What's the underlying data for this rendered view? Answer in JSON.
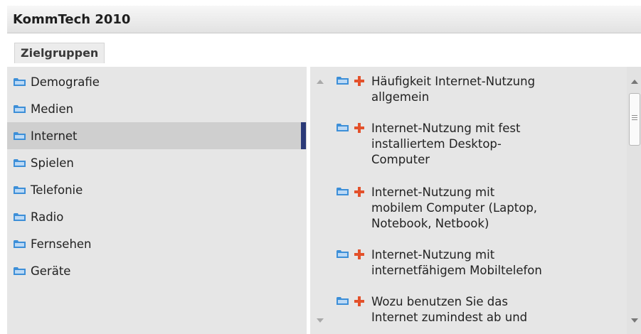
{
  "app": {
    "title": "KommTech 2010"
  },
  "tabs": [
    {
      "label": "Zielgruppen"
    }
  ],
  "categories": [
    {
      "label": "Demografie"
    },
    {
      "label": "Medien"
    },
    {
      "label": "Internet",
      "selected": true
    },
    {
      "label": "Spielen"
    },
    {
      "label": "Telefonie"
    },
    {
      "label": "Radio"
    },
    {
      "label": "Fernsehen"
    },
    {
      "label": "Geräte"
    }
  ],
  "items": [
    {
      "lines": [
        "Häufigkeit Internet-Nutzung",
        "allgemein"
      ]
    },
    {
      "lines": [
        "Internet-Nutzung mit fest",
        "installiertem Desktop-",
        "Computer"
      ]
    },
    {
      "lines": [
        "Internet-Nutzung mit",
        "mobilem Computer (Laptop,",
        "Notebook, Netbook)"
      ]
    },
    {
      "lines": [
        "Internet-Nutzung mit",
        "internetfähigem Mobiltelefon"
      ]
    },
    {
      "lines": [
        "Wozu benutzen Sie das",
        "Internet zumindest ab und"
      ]
    }
  ],
  "icons": {
    "folder": "folder-icon",
    "add": "plus-icon",
    "scroll_up": "scroll-up-arrow-icon",
    "scroll_down": "scroll-down-arrow-icon"
  },
  "colors": {
    "folder_blue": "#3d8fd8",
    "plus_red": "#e3512b",
    "selection_bar": "#2b3a78"
  }
}
